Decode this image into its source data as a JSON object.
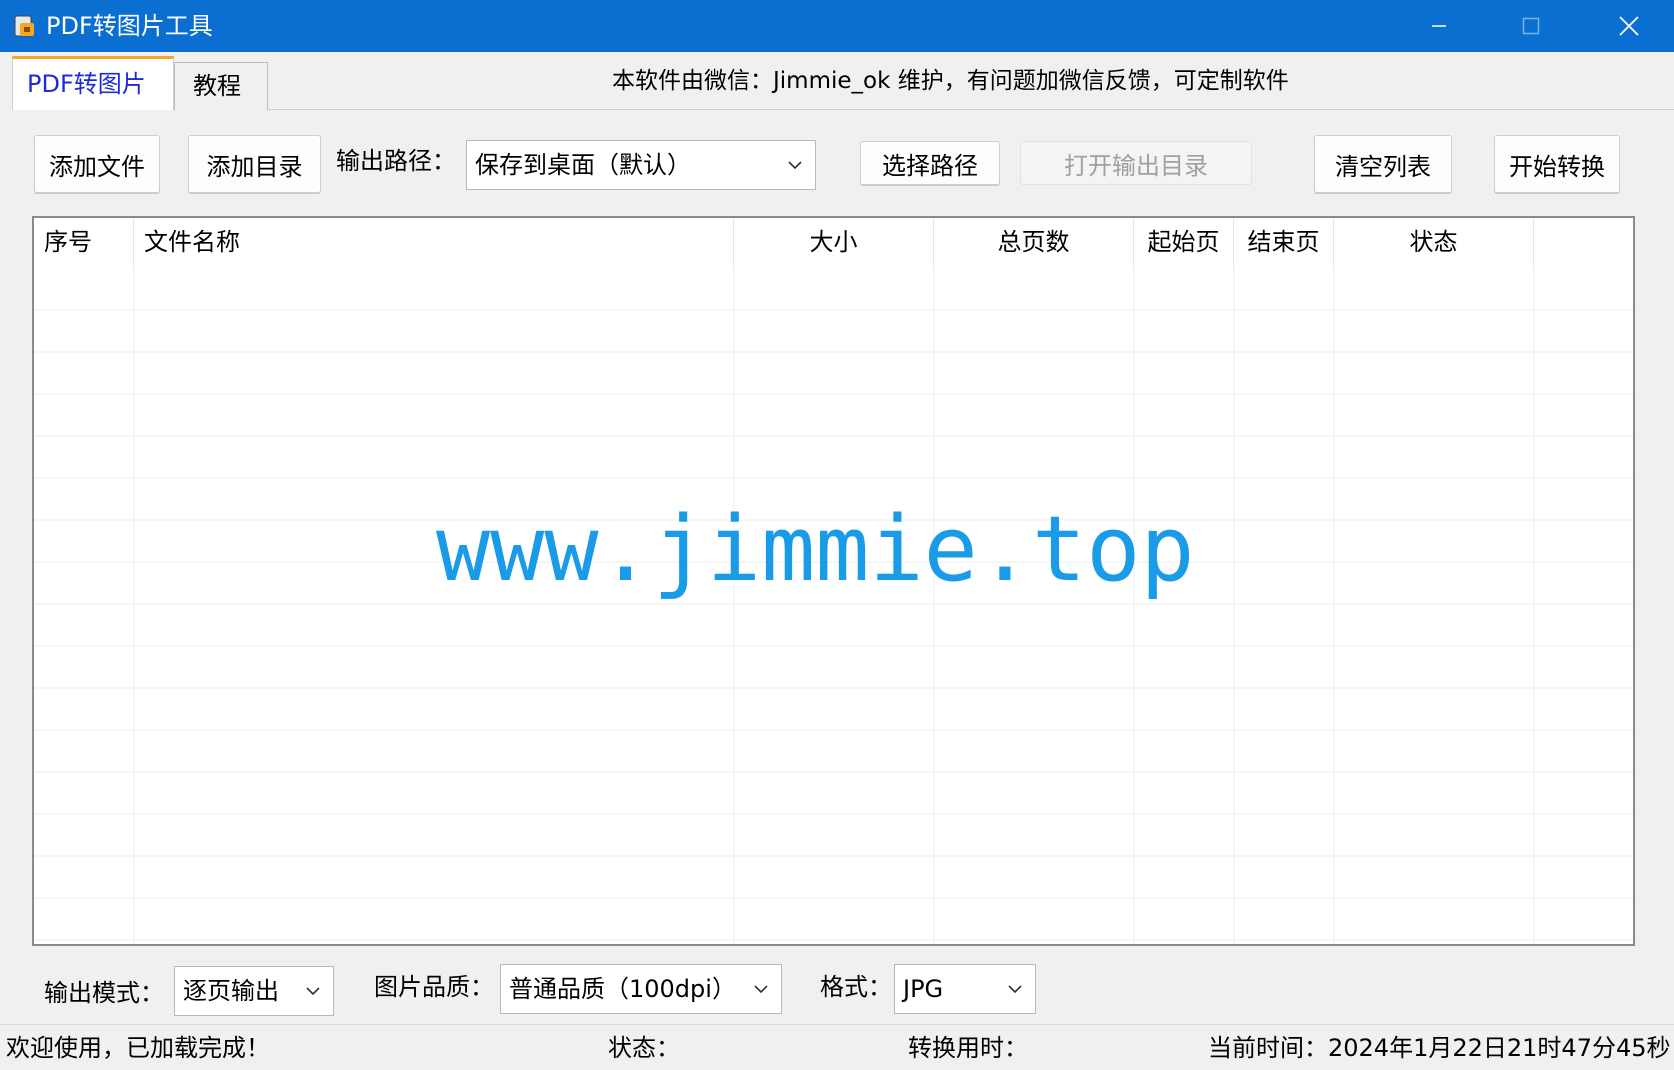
{
  "window": {
    "title": "PDF转图片工具"
  },
  "tabs": [
    {
      "label": "PDF转图片"
    },
    {
      "label": "教程"
    }
  ],
  "notice": "本软件由微信：Jimmie_ok 维护，有问题加微信反馈，可定制软件",
  "toolbar": {
    "add_file": "添加文件",
    "add_dir": "添加目录",
    "output_path_label": "输出路径：",
    "output_path_value": "保存到桌面（默认）",
    "choose_path": "选择路径",
    "open_output_dir": "打开输出目录",
    "clear_list": "清空列表",
    "start_convert": "开始转换"
  },
  "table": {
    "columns": [
      "序号",
      "文件名称",
      "大小",
      "总页数",
      "起始页",
      "结束页",
      "状态"
    ],
    "rows": []
  },
  "watermark": "www.jimmie.top",
  "options": {
    "mode_label": "输出模式：",
    "mode_value": "逐页输出",
    "quality_label": "图片品质：",
    "quality_value": "普通品质（100dpi）",
    "format_label": "格式：",
    "format_value": "JPG"
  },
  "statusbar": {
    "welcome": "欢迎使用，已加载完成！",
    "status_label": "状态：",
    "elapsed_label": "转换用时：",
    "current_time": "当前时间：2024年1月22日21时47分45秒"
  },
  "colors": {
    "titlebar": "#0a6fd0",
    "active_tab_text": "#1d2bd6",
    "tab_accent": "#f5a623",
    "watermark": "#1a9be8"
  }
}
